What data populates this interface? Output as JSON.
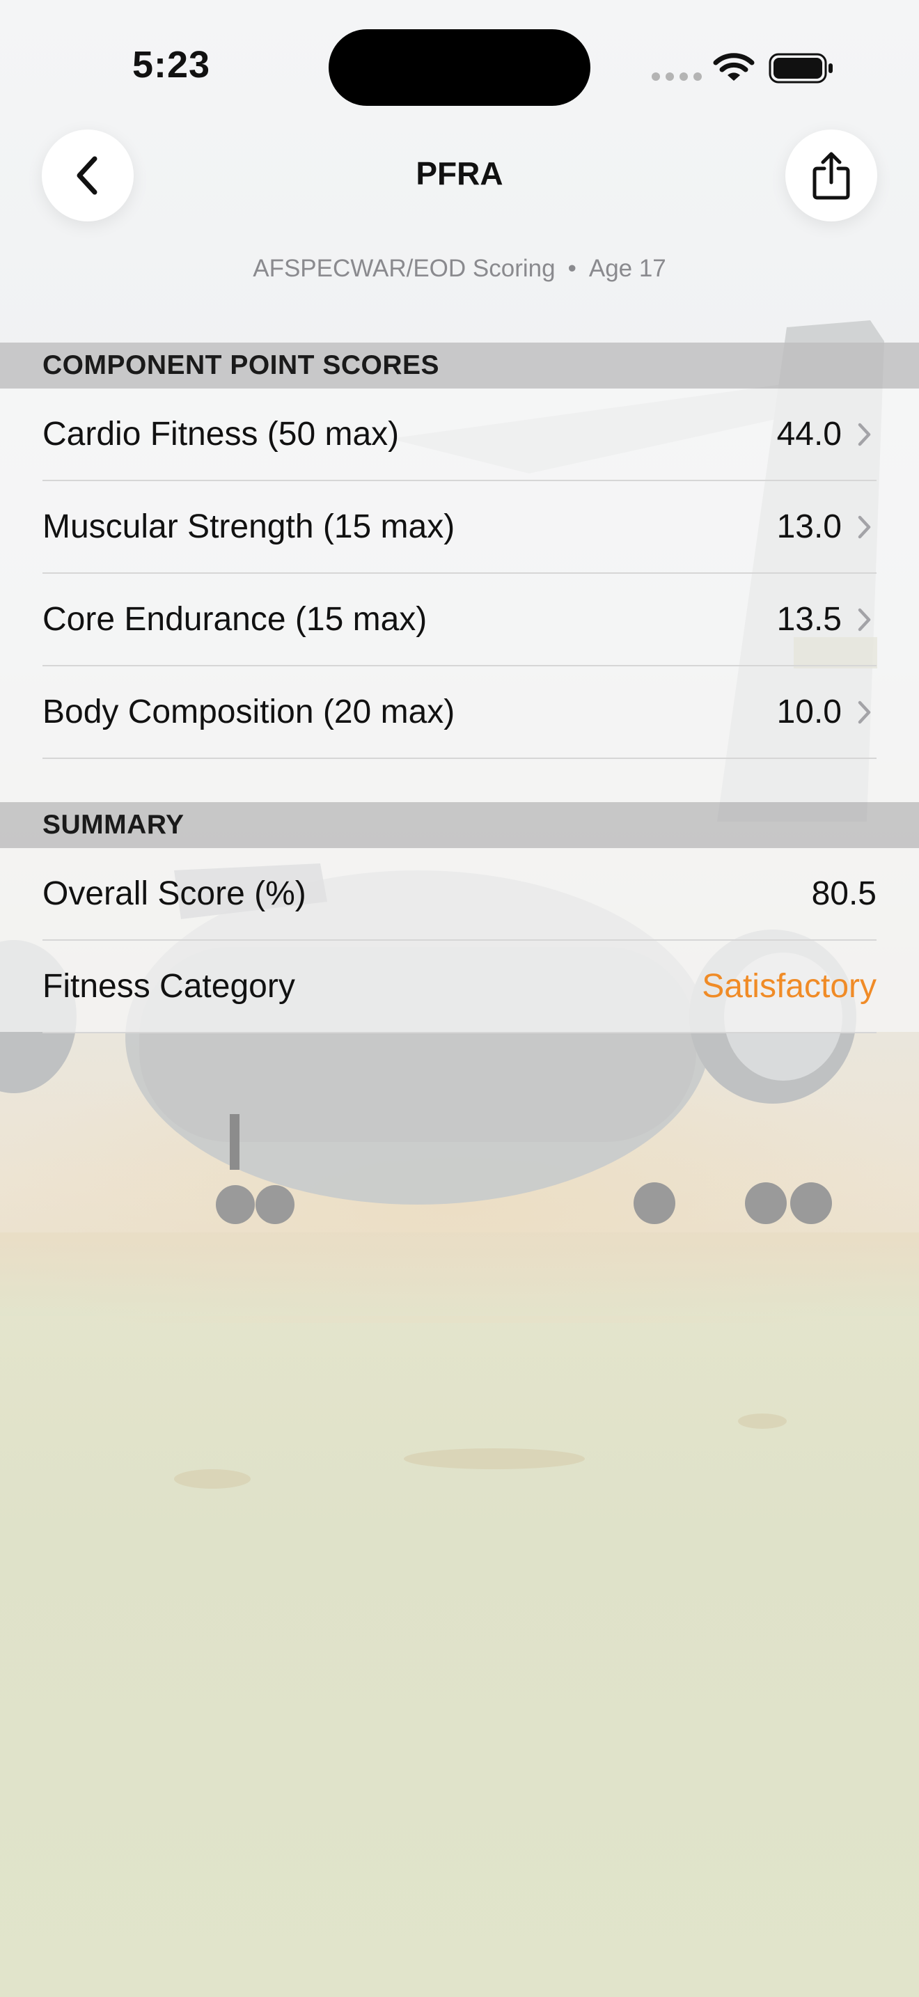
{
  "status_bar": {
    "time": "5:23"
  },
  "nav": {
    "title": "PFRA",
    "back_icon": "chevron-left-icon",
    "share_icon": "share-icon"
  },
  "subtitle": {
    "scoring": "AFSPECWAR/EOD Scoring",
    "separator": "•",
    "age": "Age 17"
  },
  "component_scores": {
    "header": "COMPONENT POINT SCORES",
    "rows": [
      {
        "label": "Cardio Fitness (50 max)",
        "value": "44.0"
      },
      {
        "label": "Muscular Strength (15 max)",
        "value": "13.0"
      },
      {
        "label": "Core Endurance (15 max)",
        "value": "13.5"
      },
      {
        "label": "Body Composition (20 max)",
        "value": "10.0"
      }
    ]
  },
  "summary": {
    "header": "SUMMARY",
    "rows": [
      {
        "label": "Overall Score (%)",
        "value": "80.5"
      },
      {
        "label": "Fitness Category",
        "value": "Satisfactory"
      }
    ]
  },
  "colors": {
    "category_accent": "#f08b26"
  }
}
